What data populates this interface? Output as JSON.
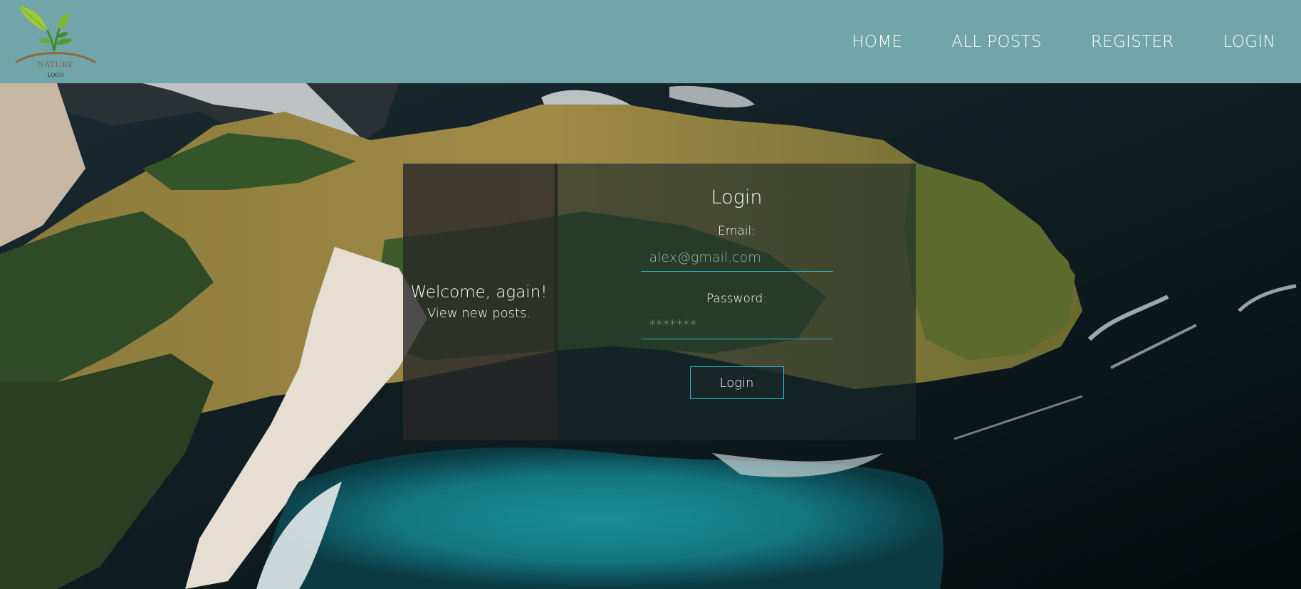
{
  "brand": {
    "logo_text": "NATURE",
    "logo_sub": "LOGO"
  },
  "nav": {
    "items": [
      {
        "label": "HOME"
      },
      {
        "label": "ALL POSTS"
      },
      {
        "label": "REGISTER"
      },
      {
        "label": "LOGIN"
      }
    ]
  },
  "welcome": {
    "title": "Welcome, again!",
    "subtitle": "View new posts."
  },
  "login_form": {
    "title": "Login",
    "email_label": "Email:",
    "email_placeholder": "alex@gmail.com",
    "password_label": "Password:",
    "password_placeholder": "*******",
    "submit_label": "Login"
  },
  "colors": {
    "header_bg": "#71a5aa",
    "accent": "#28b8c2"
  },
  "icons": [
    "leaf-logo-icon"
  ]
}
